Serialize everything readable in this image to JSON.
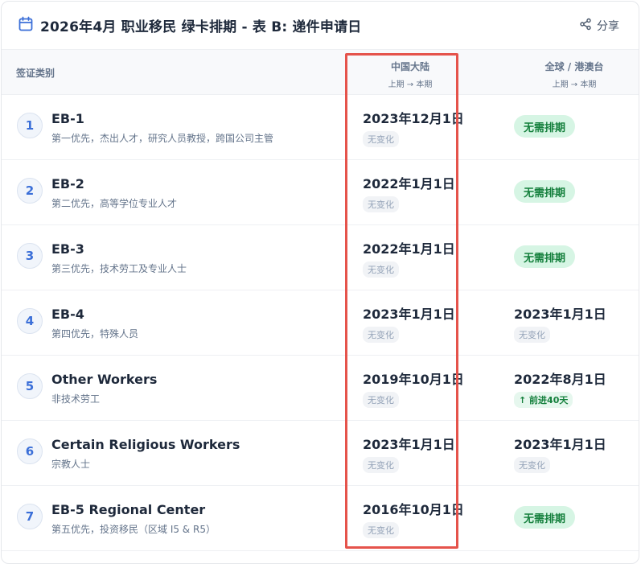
{
  "header": {
    "title": "2026年4月 职业移民 绿卡排期 - 表 B: 递件申请日",
    "share_label": "分享"
  },
  "table": {
    "col_category": "签证类别",
    "col_cn": {
      "name": "中国大陆",
      "sub": "上期 → 本期"
    },
    "col_global": {
      "name": "全球 / 港澳台",
      "sub": "上期 → 本期"
    },
    "rows": [
      {
        "num": "1",
        "name": "EB-1",
        "desc": "第一优先，杰出人才，研究人员教授，跨国公司主管",
        "cn_date": "2023年12月1日",
        "cn_change": "无变化",
        "global_current": "无需排期"
      },
      {
        "num": "2",
        "name": "EB-2",
        "desc": "第二优先，高等学位专业人才",
        "cn_date": "2022年1月1日",
        "cn_change": "无变化",
        "global_current": "无需排期"
      },
      {
        "num": "3",
        "name": "EB-3",
        "desc": "第三优先，技术劳工及专业人士",
        "cn_date": "2022年1月1日",
        "cn_change": "无变化",
        "global_current": "无需排期"
      },
      {
        "num": "4",
        "name": "EB-4",
        "desc": "第四优先，特殊人员",
        "cn_date": "2023年1月1日",
        "cn_change": "无变化",
        "global_date": "2023年1月1日",
        "global_change": "无变化"
      },
      {
        "num": "5",
        "name": "Other Workers",
        "desc": "非技术劳工",
        "cn_date": "2019年10月1日",
        "cn_change": "无变化",
        "global_date": "2022年8月1日",
        "global_change": "↑ 前进40天"
      },
      {
        "num": "6",
        "name": "Certain Religious Workers",
        "desc": "宗教人士",
        "cn_date": "2023年1月1日",
        "cn_change": "无变化",
        "global_date": "2023年1月1日",
        "global_change": "无变化"
      },
      {
        "num": "7",
        "name": "EB-5 Regional Center",
        "desc": "第五优先，投资移民（区域 I5 & R5）",
        "cn_date": "2016年10月1日",
        "cn_change": "无变化",
        "global_current": "无需排期"
      }
    ]
  },
  "colors": {
    "accent": "#3b6fd8",
    "current_bg": "#d6f5e4",
    "current_text": "#15803d",
    "highlight": "#e5534b"
  },
  "icons": {
    "title": "calendar-icon",
    "share": "share-icon"
  }
}
